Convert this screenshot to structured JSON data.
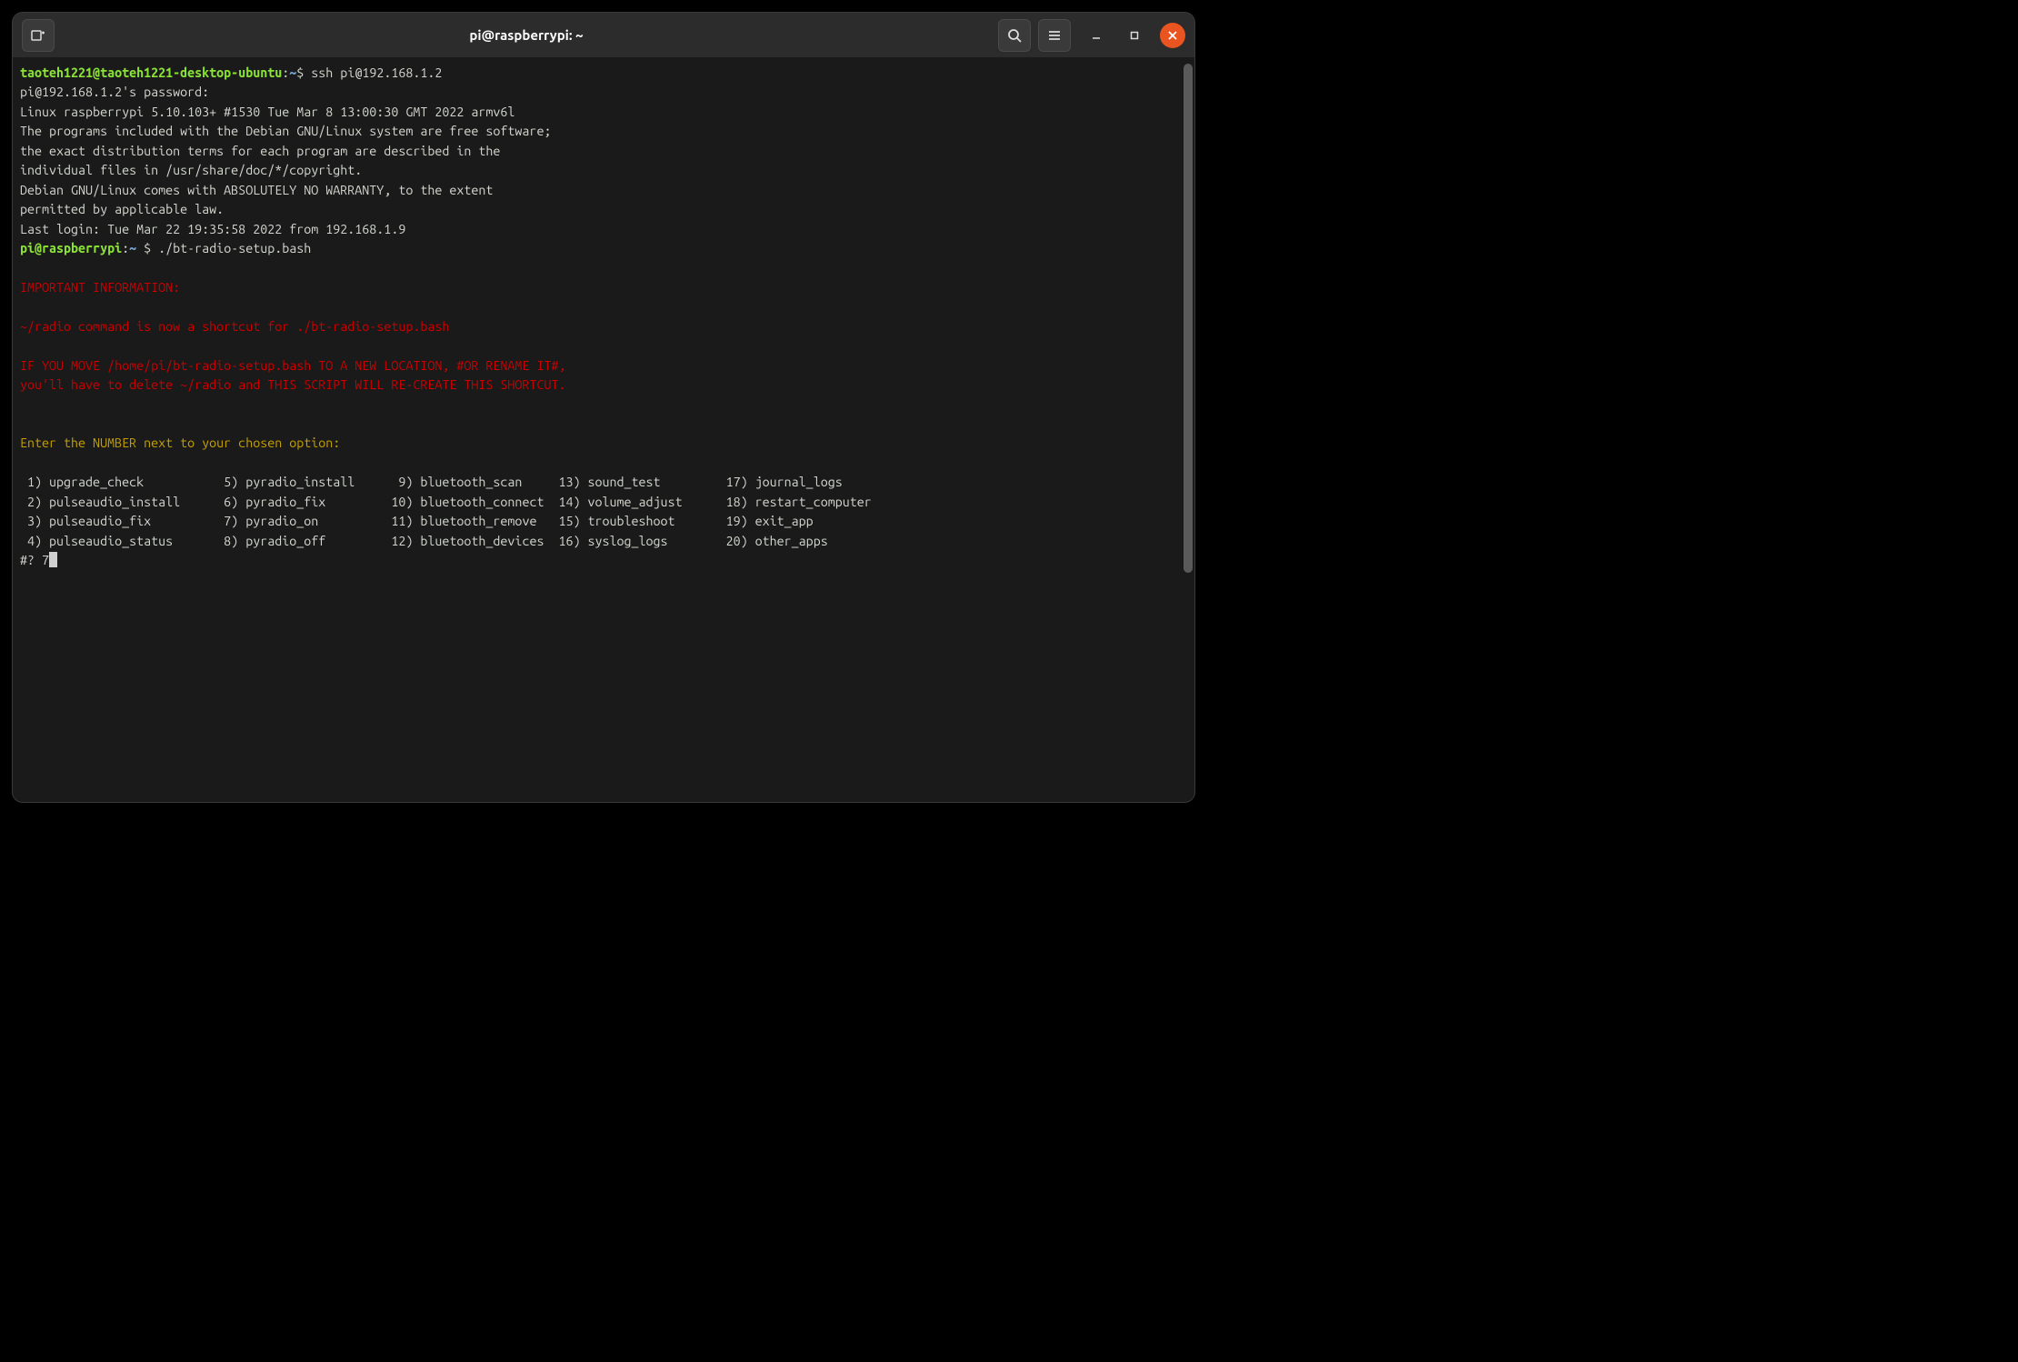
{
  "window_title": "pi@raspberrypi: ~",
  "prompt1": {
    "user_host": "taoteh1221@taoteh1221-desktop-ubuntu",
    "sep": ":",
    "path": "~",
    "dollar": "$",
    "cmd": " ssh pi@192.168.1.2"
  },
  "login": {
    "pw_line": "pi@192.168.1.2's password:",
    "kernel": "Linux raspberrypi 5.10.103+ #1530 Tue Mar 8 13:00:30 GMT 2022 armv6l",
    "blank": "",
    "motd1": "The programs included with the Debian GNU/Linux system are free software;",
    "motd2": "the exact distribution terms for each program are described in the",
    "motd3": "individual files in /usr/share/doc/*/copyright.",
    "motd4": "Debian GNU/Linux comes with ABSOLUTELY NO WARRANTY, to the extent",
    "motd5": "permitted by applicable law.",
    "lastlogin": "Last login: Tue Mar 22 19:35:58 2022 from 192.168.1.9"
  },
  "prompt2": {
    "user_host": "pi@raspberrypi",
    "sep": ":",
    "path": "~ ",
    "dollar": "$",
    "cmd": " ./bt-radio-setup.bash"
  },
  "red_block": {
    "l1": "IMPORTANT INFORMATION:",
    "l2": "~/radio command is now a shortcut for ./bt-radio-setup.bash",
    "l3": "IF YOU MOVE /home/pi/bt-radio-setup.bash TO A NEW LOCATION, #OR RENAME IT#,",
    "l4": "you'll have to delete ~/radio and THIS SCRIPT WILL RE-CREATE THIS SHORTCUT."
  },
  "menu": {
    "prompt": "Enter the NUMBER next to your chosen option:",
    "row1": " 1) upgrade_check\t    5) pyradio_install\t    9) bluetooth_scan\t  13) sound_test\t 17) journal_logs",
    "row2": " 2) pulseaudio_install\t    6) pyradio_fix\t   10) bluetooth_connect  14) volume_adjust\t 18) restart_computer",
    "row3": " 3) pulseaudio_fix\t    7) pyradio_on\t   11) bluetooth_remove\t  15) troubleshoot\t 19) exit_app",
    "row4": " 4) pulseaudio_status\t    8) pyradio_off\t   12) bluetooth_devices  16) syslog_logs\t 20) other_apps",
    "input_prompt": "#? ",
    "input_value": "7"
  }
}
